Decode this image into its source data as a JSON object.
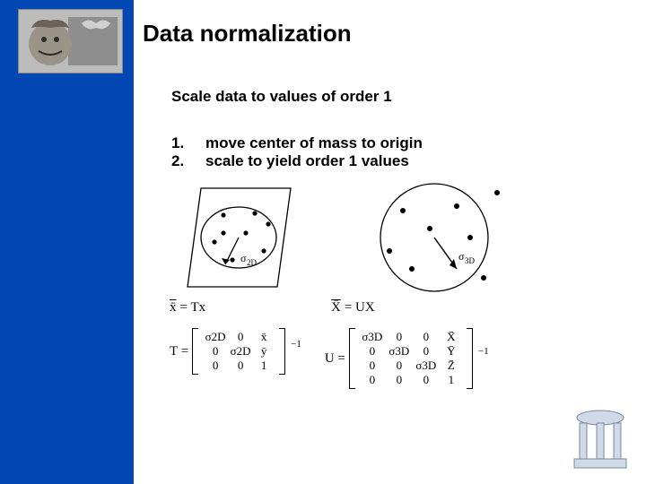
{
  "title": "Data normalization",
  "subtitle": "Scale data to values of order 1",
  "steps": [
    {
      "n": "1.",
      "t": "move center of mass to origin"
    },
    {
      "n": "2.",
      "t": "scale to yield order 1 values"
    }
  ],
  "sigma2d_label": "σ2D",
  "sigma3d_label": "σ3D",
  "eq_xbar_Tx_l": "x̄",
  "eq_xbar_Tx_r": "= Tx",
  "eq_Xbar_UX_l": "X̄",
  "eq_Xbar_UX_r": "= UX",
  "T_label": "T =",
  "U_label": "U =",
  "inv": "−1",
  "T": {
    "r0": [
      "σ2D",
      "0",
      "x̄"
    ],
    "r1": [
      "0",
      "σ2D",
      "ȳ"
    ],
    "r2": [
      "0",
      "0",
      "1"
    ]
  },
  "U": {
    "r0": [
      "σ3D",
      "0",
      "0",
      "X̄"
    ],
    "r1": [
      "0",
      "σ3D",
      "0",
      "Ȳ"
    ],
    "r2": [
      "0",
      "0",
      "σ3D",
      "Z̄"
    ],
    "r3": [
      "0",
      "0",
      "0",
      "1"
    ]
  },
  "chart_data": {
    "type": "table",
    "title": "Data normalization transforms",
    "T_matrix": [
      [
        "σ2D",
        "0",
        "x̄"
      ],
      [
        "0",
        "σ2D",
        "ȳ"
      ],
      [
        "0",
        "0",
        "1"
      ]
    ],
    "U_matrix": [
      [
        "σ3D",
        "0",
        "0",
        "X̄"
      ],
      [
        "0",
        "σ3D",
        "0",
        "Ȳ"
      ],
      [
        "0",
        "0",
        "σ3D",
        "Z̄"
      ],
      [
        "0",
        "0",
        "0",
        "1"
      ]
    ],
    "relations": [
      "x̄ = T x",
      "X̄ = U X"
    ],
    "sigma_2d_points_2d_diagram": 8,
    "sigma_3d_points_3d_diagram": 8
  }
}
